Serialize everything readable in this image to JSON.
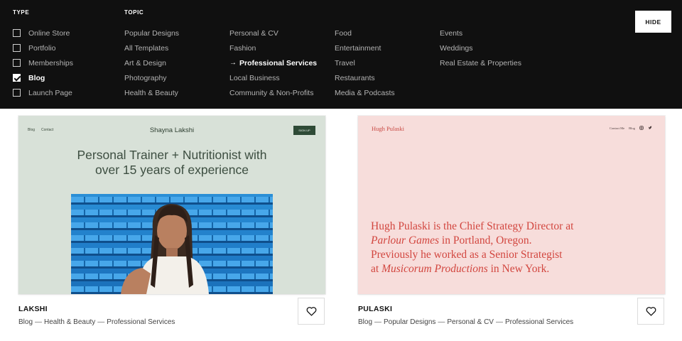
{
  "filters": {
    "type_heading": "TYPE",
    "topic_heading": "TOPIC",
    "types": [
      {
        "label": "Online Store",
        "checked": false
      },
      {
        "label": "Portfolio",
        "checked": false
      },
      {
        "label": "Memberships",
        "checked": false
      },
      {
        "label": "Blog",
        "checked": true
      },
      {
        "label": "Launch Page",
        "checked": false
      }
    ],
    "topic_columns": [
      [
        "Popular Designs",
        "All Templates",
        "Art & Design",
        "Photography",
        "Health & Beauty"
      ],
      [
        "Personal & CV",
        "Fashion",
        "Professional Services",
        "Local Business",
        "Community & Non-Profits"
      ],
      [
        "Food",
        "Entertainment",
        "Travel",
        "Restaurants",
        "Media & Podcasts"
      ],
      [
        "Events",
        "Weddings",
        "Real Estate & Properties"
      ]
    ],
    "active_topic": "Professional Services",
    "hide_label": "HIDE"
  },
  "cards": [
    {
      "name": "LAKSHI",
      "tags": [
        "Blog",
        "Health & Beauty",
        "Professional Services"
      ],
      "preview": {
        "nav_links": [
          "Blog",
          "Contact"
        ],
        "brand": "Shayna Lakshi",
        "cta": "SIGN UP",
        "headline_line1": "Personal Trainer + Nutritionist with",
        "headline_line2": "over 15 years of experience"
      }
    },
    {
      "name": "PULASKI",
      "tags": [
        "Blog",
        "Popular Designs",
        "Personal & CV",
        "Professional Services"
      ],
      "preview": {
        "brand": "Hugh Pulaski",
        "nav_links": [
          "Contact Me",
          "Blog"
        ],
        "text_line1": "Hugh Pulaski is the Chief Strategy Director at",
        "company1": "Parlour Games",
        "text_line2_rest": " in Portland, Oregon.",
        "text_line3": "Previously he worked as a Senior Strategist",
        "text_line4_start": "at ",
        "company2": "Musicorum Productions",
        "text_line4_end": " in New York."
      }
    }
  ],
  "tag_separator": "—",
  "icons": {
    "favorite": "heart-icon",
    "active_topic": "arrow-right-icon",
    "checked": "checkmark-icon",
    "social": [
      "instagram-icon",
      "twitter-icon"
    ]
  },
  "colors": {
    "panel_bg": "#101010",
    "lakshi_bg": "#d8e1d8",
    "pulaski_bg": "#f7dddb",
    "pulaski_accent": "#d2463f"
  }
}
